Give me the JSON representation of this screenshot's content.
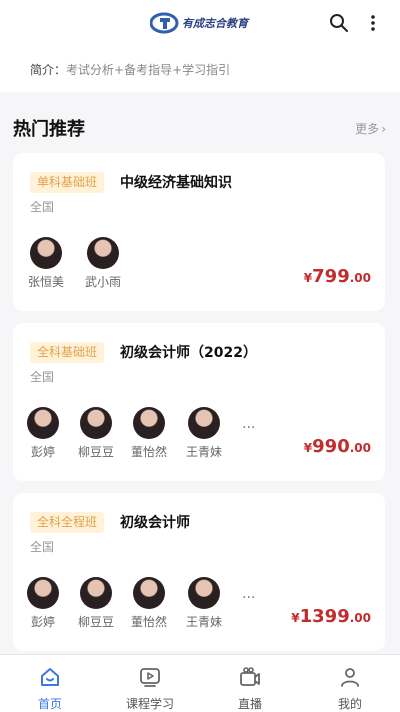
{
  "header": {
    "logo_text": "有成志合教育",
    "icons": [
      "search-icon",
      "more-icon"
    ]
  },
  "intro": {
    "label": "简介：",
    "value": "考试分析+备考指导+学习指引"
  },
  "section": {
    "title": "热门推荐",
    "more": "更多",
    "more_icon": "chevron-right-icon"
  },
  "cards": [
    {
      "tag": "单科基础班",
      "title": "中级经济基础知识",
      "scope": "全国",
      "teachers": [
        "张恒美",
        "武小雨"
      ],
      "price_symbol": "¥",
      "price_int": "799",
      "price_dec": ".00"
    },
    {
      "tag": "全科基础班",
      "title": "初级会计师（2022）",
      "scope": "全国",
      "teachers": [
        "彭婷",
        "柳豆豆",
        "董怡然",
        "王青妹"
      ],
      "more_teachers": "···",
      "price_symbol": "¥",
      "price_int": "990",
      "price_dec": ".00"
    },
    {
      "tag": "全科全程班",
      "title": "初级会计师",
      "scope": "全国",
      "teachers": [
        "彭婷",
        "柳豆豆",
        "董怡然",
        "王青妹"
      ],
      "more_teachers": "···",
      "price_symbol": "¥",
      "price_int": "1399",
      "price_dec": ".00"
    }
  ],
  "nav": {
    "items": [
      {
        "label": "首页",
        "icon": "home-icon",
        "active": true
      },
      {
        "label": "课程学习",
        "icon": "video-icon",
        "active": false
      },
      {
        "label": "直播",
        "icon": "live-icon",
        "active": false
      },
      {
        "label": "我的",
        "icon": "profile-icon",
        "active": false
      }
    ],
    "active_color": "#3f78e0"
  },
  "colors": {
    "accent": "#3f78e0",
    "price": "#c12c2c",
    "tag_text": "#e2a24b",
    "tag_bg": "#fff2d8"
  }
}
